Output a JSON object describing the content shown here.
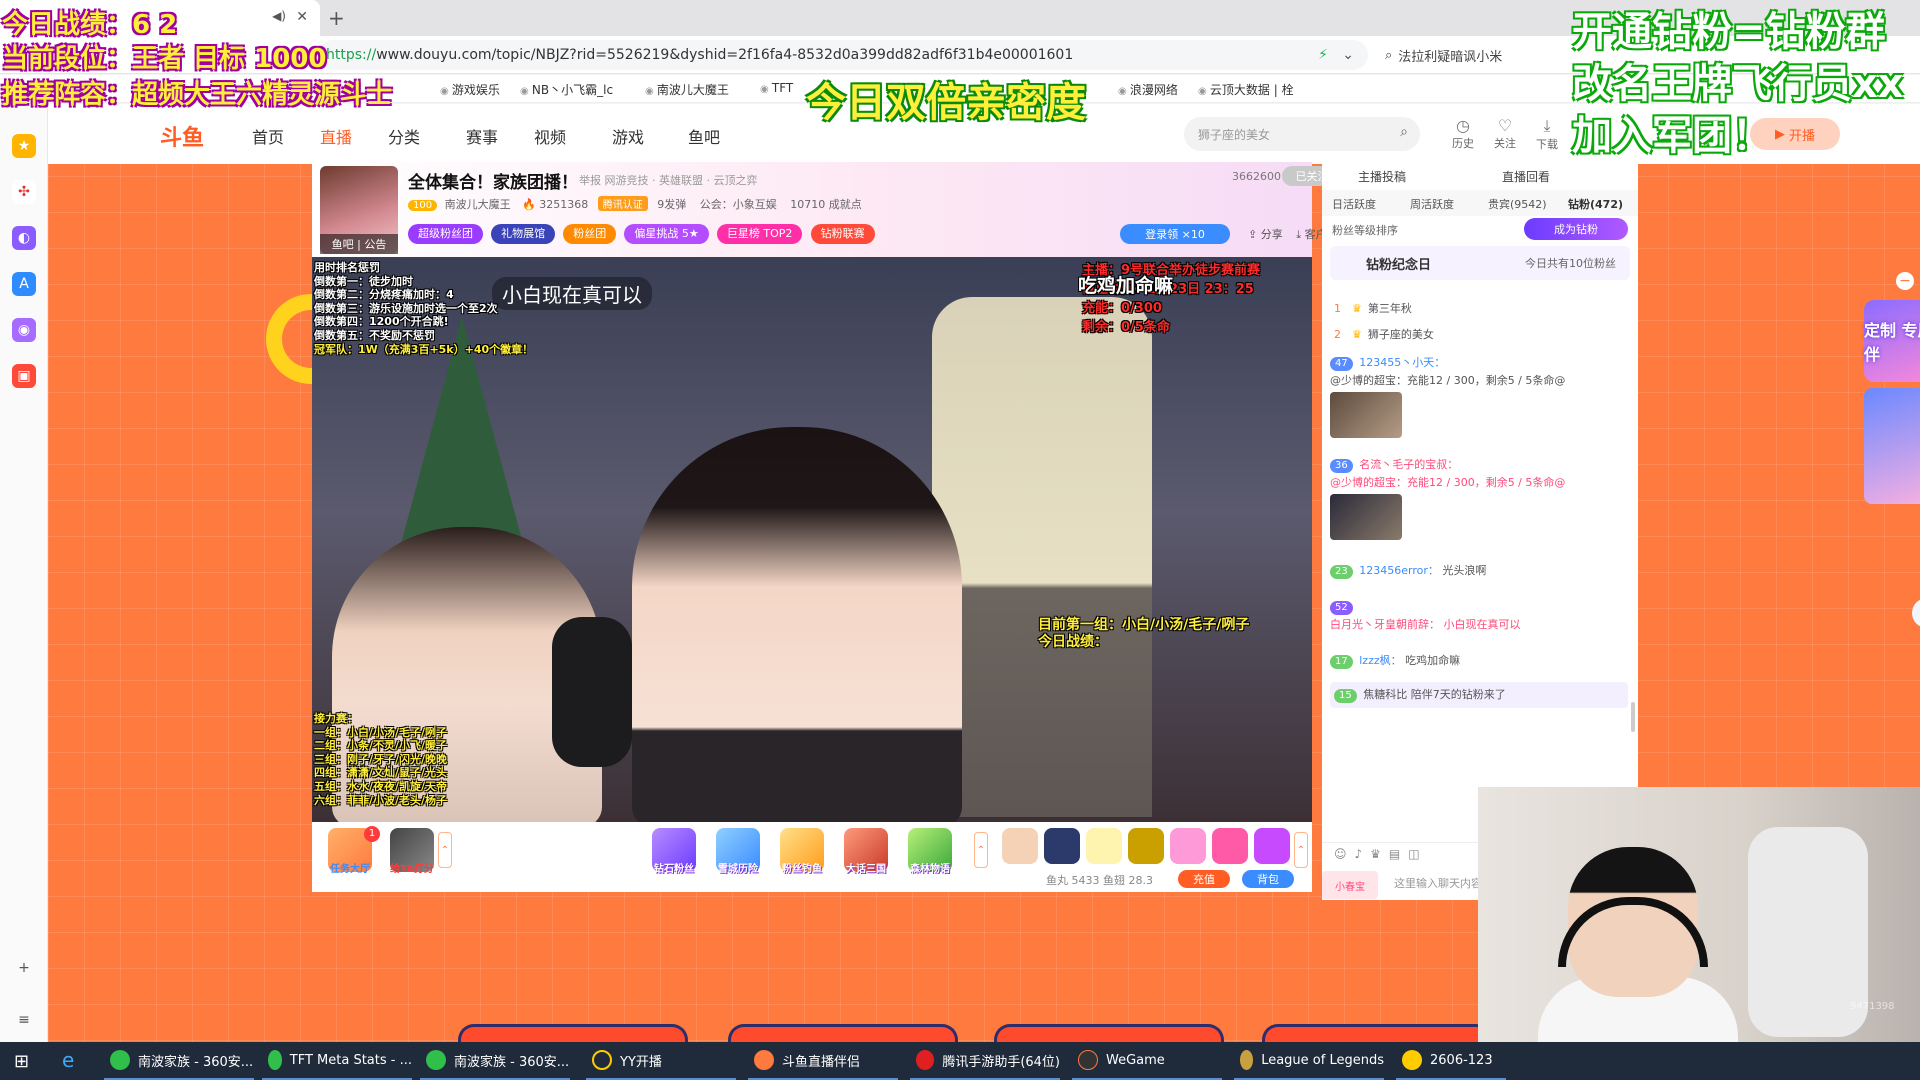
{
  "browser": {
    "tab_title": "",
    "url_scheme": "https://",
    "url_rest": "www.douyu.com/topic/NBJZ?rid=5526219&dyshid=2f16fa4-8532d0a399dd82adf6f31b4e00001601",
    "search_text": "法拉利疑暗讽小米",
    "new_tab": "+",
    "bookmarks": [
      "游戏娱乐",
      "NB丶小飞霸_lc",
      "南波儿大魔王",
      "TFT",
      "浪漫网络",
      "云顶大数据 | 栓"
    ]
  },
  "nav": {
    "logo": "斗鱼",
    "items": [
      "首页",
      "直播",
      "分类",
      "赛事",
      "视频",
      "游戏",
      "鱼吧"
    ],
    "search_placeholder": "狮子座的美女",
    "tools": [
      "历史",
      "关注",
      "下载"
    ],
    "open_live": "开播"
  },
  "room": {
    "title": "全体集合！家族团播！",
    "tags": "举报    网游竞技 · 英雄联盟 · 云顶之弈",
    "viewer_count": "3662600",
    "follow": "已关注",
    "avatar_bar": "鱼吧 | 公告",
    "level": "100",
    "anchor": "南波儿大魔王",
    "heat": "3251368",
    "cert": "腾讯认证",
    "fans": "9发弹",
    "guild": "公会：小象互娱",
    "power": "10710 成就点",
    "badges": [
      "超级粉丝团",
      "礼物展馆",
      "粉丝团",
      "偏星挑战 5★",
      "巨星榜 TOP2",
      "钻粉联赛"
    ],
    "login_btn": "登录领 ×10",
    "share": "分享",
    "client": "客户端"
  },
  "video": {
    "timer_lines": [
      "用时排名惩罚",
      "倒数第一：徒步加时",
      "倒数第二：分烧疼痛加时：4",
      "倒数第三：游乐设施加时选一个至2次",
      "倒数第四：1200个开合跳!",
      "倒数第五：不奖励不惩罚",
      "冠军队：1W（充满3百+5k）+40个徽章！"
    ],
    "caption": "小白现在真可以",
    "event_lines": [
      "主播：9号联合举办徒步赛前赛",
      "截止时间：1月23日 23：25",
      "充能：0/300",
      "剩余：0/5条命"
    ],
    "eat_chicken": "吃鸡加命嘛",
    "group_lines": [
      "目前第一组：小白/小汤/毛子/咧子",
      "今日战绩："
    ],
    "relay_lines": [
      "接力赛：",
      "一组：小白/小汤/毛子/咧子",
      "二组：小条/不灵/小飞/暖子",
      "三组：刚子/牙子/闪光/晚晚",
      "四组：潇潇/文灿/鼠子/光头",
      "五组：水水/夜夜/凯旋/天帝",
      "六组：菲菲/小波/老头/杨子"
    ]
  },
  "giftbar": {
    "left_items": [
      "任务大厅",
      "给TA打分"
    ],
    "left_badge": "1",
    "mid_items": [
      "钻石粉丝",
      "雪城历险",
      "粉丝钓鱼",
      "大话三国",
      "森林物语"
    ],
    "fishball": "鱼丸 5433   鱼翅 28.3",
    "charge": "充值",
    "bag": "背包"
  },
  "panel": {
    "tabs_top": [
      "主播投稿",
      "直播回看"
    ],
    "tabs": [
      "日活跃度",
      "周活跃度",
      "贵宾(9542)",
      "钻粉(472)"
    ],
    "sort_label": "粉丝等级排序",
    "become_fan": "成为钻粉",
    "anniversary": "钻粉纪念日",
    "anniversary_note": "今日共有10位粉丝",
    "ranks": [
      {
        "n": "1",
        "name": "第三年秋"
      },
      {
        "n": "2",
        "name": "狮子座的美女"
      }
    ],
    "chats": [
      {
        "lvl": "47",
        "user": "123455丶小天：",
        "text": "@少博的超宝：充能12 / 300，剩余5 / 5条命@"
      },
      {
        "lvl": "36",
        "user": "名流丶毛子的宝叔：",
        "text": "@少博的超宝：充能12 / 300，剩余5 / 5条命@"
      },
      {
        "lvl": "23",
        "user": "123456error：",
        "text": "光头浪啊"
      },
      {
        "lvl": "52",
        "user": "白月光丶牙皇朝前辞：",
        "text": "小白现在真可以"
      },
      {
        "lvl": "17",
        "user": "lzzz枫：",
        "text": "吃鸡加命嘛"
      },
      {
        "lvl": "15",
        "user": "",
        "text": "焦糖科比 陪伴7天的钻粉来了"
      }
    ],
    "input_placeholder": "这里输入聊天内容",
    "xiaochun": "小春宝"
  },
  "float": {
    "card": "定制 专属陪伴",
    "minus": "−",
    "translate": "译"
  },
  "streamer": {
    "line1": "今日战绩：6 2",
    "line2": "当前段位：王者 目标 1000",
    "line3": "推荐阵容：超频大王六精灵源斗士",
    "center": "今日双倍亲密度",
    "right1": "开通钻粉=钻粉群",
    "right2": "改名王牌飞行员xx",
    "right3": "加入军团！",
    "watermark": "9471398"
  },
  "taskbar": {
    "items": [
      "南波家族 - 360安...",
      "TFT Meta Stats - ...",
      "南波家族 - 360安...",
      "YY开播",
      "斗鱼直播伴侣",
      "腾讯手游助手(64位)",
      "WeGame",
      "League of Legends",
      "2606-123"
    ]
  },
  "colors": {
    "accent": "#ff5d23",
    "page_bg": "#ff7a3e",
    "overlay_yellow": "#ffef3a"
  }
}
